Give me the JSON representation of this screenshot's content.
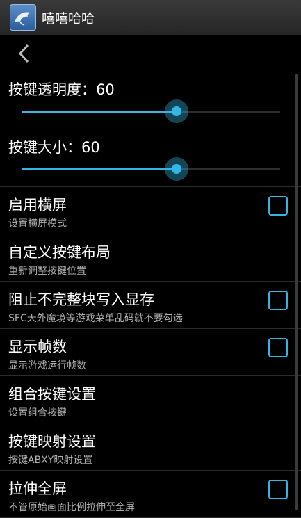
{
  "app": {
    "title": "嘻嘻哈哈",
    "icon": "dolphin-icon"
  },
  "nav": {
    "back_icon": "chevron-left-icon"
  },
  "accent_color": "#33b5e5",
  "settings": [
    {
      "type": "slider",
      "title": "按键透明度：60",
      "value": 60,
      "max": 100
    },
    {
      "type": "slider",
      "title": "按键大小：60",
      "value": 60,
      "max": 100
    },
    {
      "type": "checkbox",
      "title": "启用横屏",
      "summary": "设置横屏模式",
      "checked": false
    },
    {
      "type": "item",
      "title": "自定义按键布局",
      "summary": "重新调整按键位置"
    },
    {
      "type": "checkbox",
      "title": "阻止不完整块写入显存",
      "summary": "SFC天外魔境等游戏菜单乱码就不要勾选",
      "checked": false
    },
    {
      "type": "checkbox",
      "title": "显示帧数",
      "summary": "显示游戏运行帧数",
      "checked": false
    },
    {
      "type": "item",
      "title": "组合按键设置",
      "summary": "设置组合按键"
    },
    {
      "type": "item",
      "title": "按键映射设置",
      "summary": "按键ABXY映射设置"
    },
    {
      "type": "checkbox",
      "title": "拉伸全屏",
      "summary": "不管原始画面比例拉伸至全屏",
      "checked": false
    }
  ]
}
